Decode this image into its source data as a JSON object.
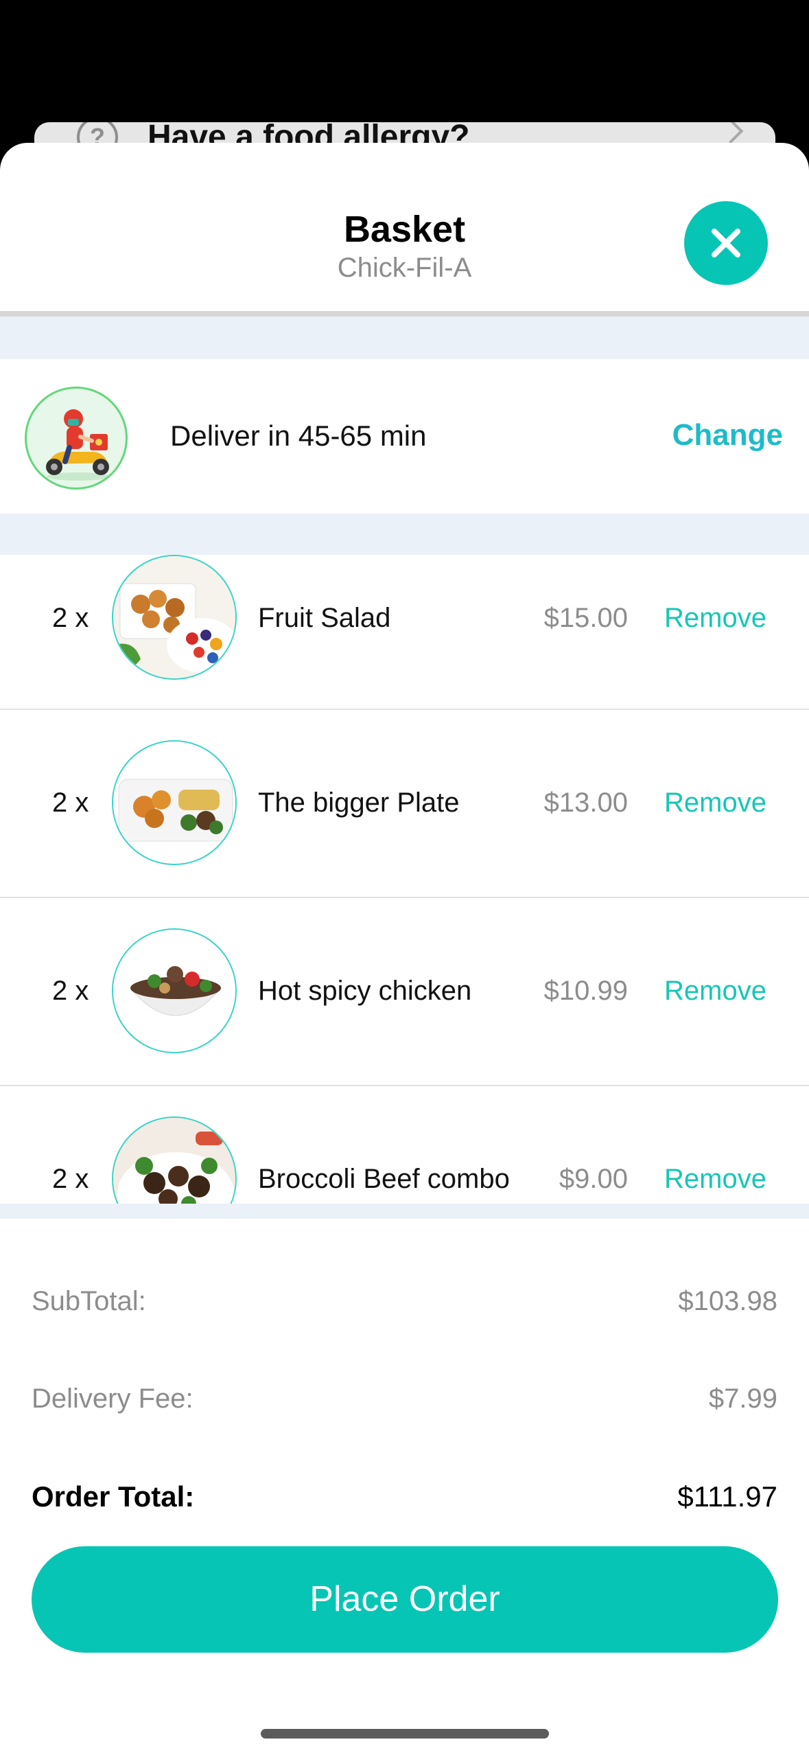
{
  "background": {
    "banner_title": "Have a food allergy?",
    "help_icon_glyph": "?"
  },
  "header": {
    "title": "Basket",
    "subtitle": "Chick-Fil-A"
  },
  "delivery": {
    "text": "Deliver in 45-65 min",
    "change_label": "Change"
  },
  "items": [
    {
      "qty": "2 x",
      "name": "Fruit Salad",
      "price": "$15.00",
      "remove_label": "Remove"
    },
    {
      "qty": "2 x",
      "name": "The bigger Plate",
      "price": "$13.00",
      "remove_label": "Remove"
    },
    {
      "qty": "2 x",
      "name": "Hot spicy chicken",
      "price": "$10.99",
      "remove_label": "Remove"
    },
    {
      "qty": "2 x",
      "name": "Broccoli Beef combo",
      "price": "$9.00",
      "remove_label": "Remove"
    }
  ],
  "summary": {
    "subtotal_label": "SubTotal:",
    "subtotal_value": "$103.98",
    "fee_label": "Delivery Fee:",
    "fee_value": "$7.99",
    "total_label": "Order Total:",
    "total_value": "$111.97"
  },
  "actions": {
    "place_order_label": "Place Order"
  },
  "colors": {
    "accent": "#07c5b4",
    "link": "#1cbcc9",
    "band": "#eaf1f8"
  }
}
